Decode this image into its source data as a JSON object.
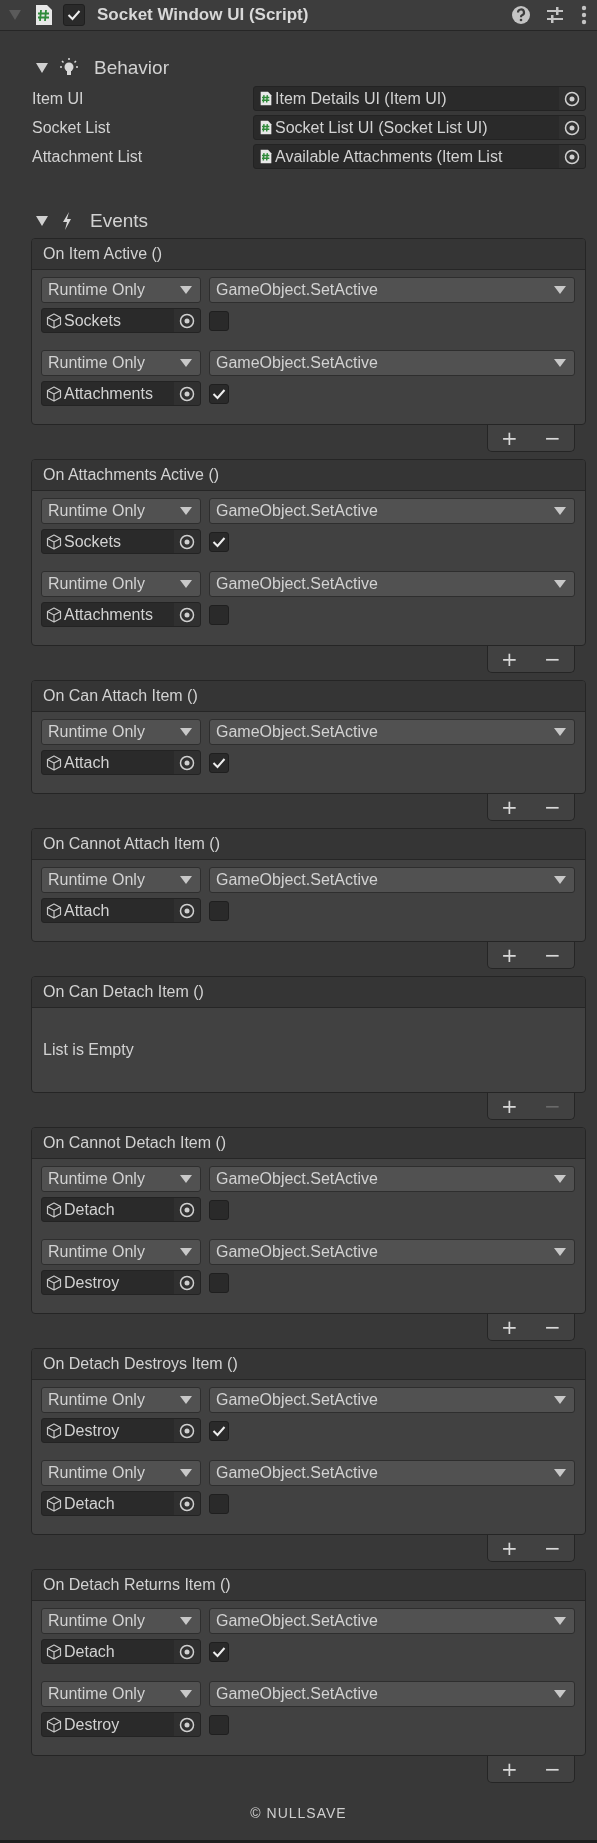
{
  "component": {
    "title": "Socket Window UI (Script)",
    "enabled": true,
    "expanded": true
  },
  "sections": [
    {
      "title": "Behavior",
      "kind": "fields",
      "expanded": true,
      "fields": [
        {
          "label": "Item UI",
          "value": "Item Details UI (Item UI)"
        },
        {
          "label": "Socket List",
          "value": "Socket List UI (Socket List UI)"
        },
        {
          "label": "Attachment List",
          "value": "Available Attachments (Item List"
        }
      ]
    },
    {
      "title": "Events",
      "kind": "events",
      "expanded": true,
      "events": [
        {
          "name": "On Item Active ()",
          "add": "+",
          "remove": "−",
          "remove_disabled": false,
          "entries": [
            {
              "mode": "Runtime Only",
              "function": "GameObject.SetActive",
              "target": "Sockets",
              "value": false
            },
            {
              "mode": "Runtime Only",
              "function": "GameObject.SetActive",
              "target": "Attachments",
              "value": true
            }
          ]
        },
        {
          "name": "On Attachments Active ()",
          "add": "+",
          "remove": "−",
          "remove_disabled": false,
          "entries": [
            {
              "mode": "Runtime Only",
              "function": "GameObject.SetActive",
              "target": "Sockets",
              "value": true
            },
            {
              "mode": "Runtime Only",
              "function": "GameObject.SetActive",
              "target": "Attachments",
              "value": false
            }
          ]
        },
        {
          "name": "On Can Attach Item ()",
          "add": "+",
          "remove": "−",
          "remove_disabled": false,
          "entries": [
            {
              "mode": "Runtime Only",
              "function": "GameObject.SetActive",
              "target": "Attach",
              "value": true
            }
          ]
        },
        {
          "name": "On Cannot Attach Item ()",
          "add": "+",
          "remove": "−",
          "remove_disabled": false,
          "entries": [
            {
              "mode": "Runtime Only",
              "function": "GameObject.SetActive",
              "target": "Attach",
              "value": false
            }
          ]
        },
        {
          "name": "On Can Detach Item ()",
          "add": "+",
          "remove": "−",
          "remove_disabled": true,
          "empty_text": "List is Empty"
        },
        {
          "name": "On Cannot Detach Item ()",
          "add": "+",
          "remove": "−",
          "remove_disabled": false,
          "entries": [
            {
              "mode": "Runtime Only",
              "function": "GameObject.SetActive",
              "target": "Detach",
              "value": false
            },
            {
              "mode": "Runtime Only",
              "function": "GameObject.SetActive",
              "target": "Destroy",
              "value": false
            }
          ]
        },
        {
          "name": "On Detach Destroys Item ()",
          "add": "+",
          "remove": "−",
          "remove_disabled": false,
          "entries": [
            {
              "mode": "Runtime Only",
              "function": "GameObject.SetActive",
              "target": "Destroy",
              "value": true
            },
            {
              "mode": "Runtime Only",
              "function": "GameObject.SetActive",
              "target": "Detach",
              "value": false
            }
          ]
        },
        {
          "name": "On Detach Returns Item ()",
          "add": "+",
          "remove": "−",
          "remove_disabled": false,
          "entries": [
            {
              "mode": "Runtime Only",
              "function": "GameObject.SetActive",
              "target": "Detach",
              "value": true
            },
            {
              "mode": "Runtime Only",
              "function": "GameObject.SetActive",
              "target": "Destroy",
              "value": false
            }
          ]
        }
      ]
    }
  ],
  "footer": "© NULLSAVE"
}
